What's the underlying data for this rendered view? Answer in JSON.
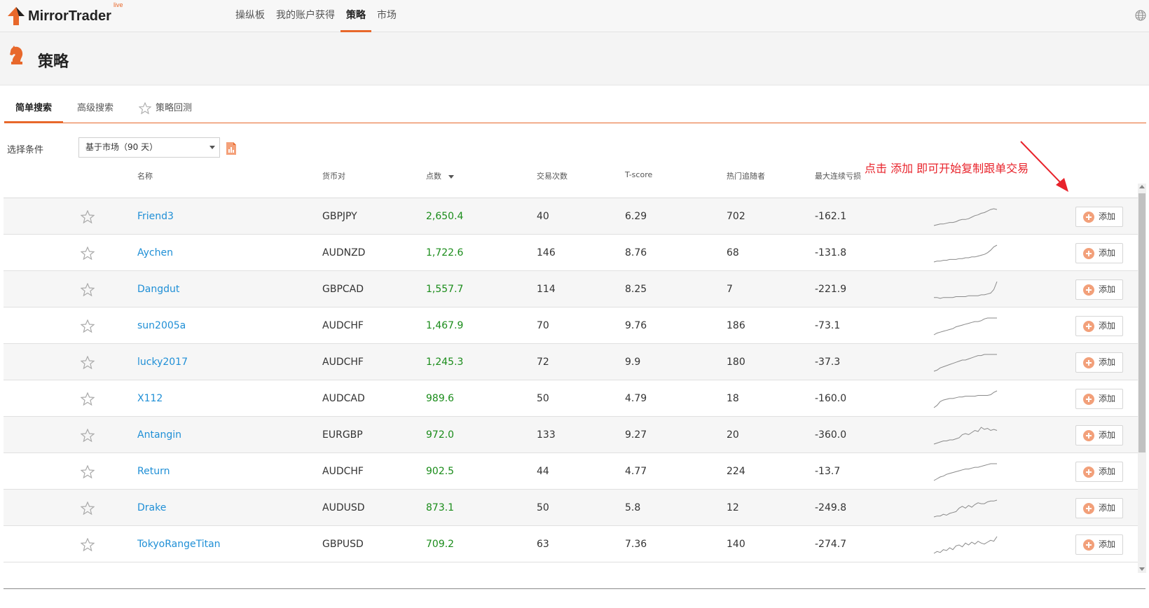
{
  "app": {
    "brand": "MirrorTrader",
    "brand_badge": "live"
  },
  "nav": {
    "items": [
      {
        "label": "操纵板",
        "active": false
      },
      {
        "label": "我的账户获得",
        "active": false
      },
      {
        "label": "策略",
        "active": true
      },
      {
        "label": "市场",
        "active": false
      }
    ]
  },
  "page": {
    "title": "策略"
  },
  "tabs": [
    {
      "label": "简单搜索",
      "active": true
    },
    {
      "label": "高级搜索",
      "active": false
    },
    {
      "label": "策略回测",
      "active": false,
      "icon": "star-outline-icon"
    }
  ],
  "filter": {
    "label": "选择条件",
    "selected": "基于市场（90 天）"
  },
  "table": {
    "headers": {
      "name": "名称",
      "pair": "货币对",
      "points": "点数",
      "trades": "交易次数",
      "tscore": "T-score",
      "followers": "热门追随者",
      "drawdown": "最大连续亏损"
    },
    "add_label": "添加",
    "rows": [
      {
        "name": "Friend3",
        "pair": "GBPJPY",
        "points": "2,650.4",
        "trades": "40",
        "tscore": "6.29",
        "followers": "702",
        "drawdown": "-162.1",
        "spark": [
          0,
          1,
          2,
          2,
          3,
          4,
          4,
          5,
          7,
          8,
          8,
          9,
          11,
          13,
          14,
          16,
          17,
          19,
          21,
          22,
          21
        ]
      },
      {
        "name": "Aychen",
        "pair": "AUDNZD",
        "points": "1,722.6",
        "trades": "146",
        "tscore": "8.76",
        "followers": "68",
        "drawdown": "-131.8",
        "spark": [
          0,
          1,
          1,
          2,
          2,
          3,
          3,
          3,
          4,
          4,
          5,
          5,
          6,
          6,
          7,
          8,
          9,
          11,
          14,
          18,
          20
        ]
      },
      {
        "name": "Dangdut",
        "pair": "GBPCAD",
        "points": "1,557.7",
        "trades": "114",
        "tscore": "8.25",
        "followers": "7",
        "drawdown": "-221.9",
        "spark": [
          1,
          1,
          0,
          1,
          1,
          1,
          1,
          2,
          2,
          2,
          2,
          3,
          3,
          3,
          3,
          4,
          4,
          5,
          6,
          10,
          19
        ]
      },
      {
        "name": "sun2005a",
        "pair": "AUDCHF",
        "points": "1,467.9",
        "trades": "70",
        "tscore": "9.76",
        "followers": "186",
        "drawdown": "-73.1",
        "spark": [
          0,
          2,
          3,
          4,
          5,
          6,
          7,
          9,
          10,
          11,
          12,
          13,
          14,
          15,
          15,
          16,
          18,
          19,
          19,
          19,
          19
        ]
      },
      {
        "name": "lucky2017",
        "pair": "AUDCHF",
        "points": "1,245.3",
        "trades": "72",
        "tscore": "9.9",
        "followers": "180",
        "drawdown": "-37.3",
        "spark": [
          0,
          1,
          3,
          4,
          5,
          6,
          7,
          8,
          9,
          10,
          10,
          11,
          12,
          13,
          14,
          14,
          15,
          15,
          15,
          15,
          15
        ]
      },
      {
        "name": "X112",
        "pair": "AUDCAD",
        "points": "989.6",
        "trades": "50",
        "tscore": "4.79",
        "followers": "18",
        "drawdown": "-160.0",
        "spark": [
          0,
          3,
          8,
          10,
          11,
          12,
          12,
          13,
          14,
          14,
          15,
          15,
          15,
          15,
          16,
          16,
          16,
          16,
          17,
          20,
          22
        ]
      },
      {
        "name": "Antangin",
        "pair": "EURGBP",
        "points": "972.0",
        "trades": "133",
        "tscore": "9.27",
        "followers": "20",
        "drawdown": "-360.0",
        "spark": [
          0,
          1,
          2,
          3,
          3,
          4,
          4,
          5,
          6,
          9,
          10,
          9,
          11,
          13,
          12,
          16,
          14,
          15,
          13,
          14,
          13
        ]
      },
      {
        "name": "Return",
        "pair": "AUDCHF",
        "points": "902.5",
        "trades": "44",
        "tscore": "4.77",
        "followers": "224",
        "drawdown": "-13.7",
        "spark": [
          0,
          2,
          4,
          5,
          7,
          8,
          9,
          10,
          11,
          12,
          13,
          13,
          14,
          15,
          15,
          16,
          17,
          18,
          19,
          19,
          19
        ]
      },
      {
        "name": "Drake",
        "pair": "AUDUSD",
        "points": "873.1",
        "trades": "50",
        "tscore": "5.8",
        "followers": "12",
        "drawdown": "-249.8",
        "spark": [
          0,
          1,
          1,
          3,
          2,
          4,
          5,
          6,
          10,
          12,
          10,
          13,
          11,
          14,
          16,
          15,
          15,
          17,
          18,
          18,
          19
        ]
      },
      {
        "name": "TokyoRangeTitan",
        "pair": "GBPUSD",
        "points": "709.2",
        "trades": "63",
        "tscore": "7.36",
        "followers": "140",
        "drawdown": "-274.7",
        "spark": [
          2,
          4,
          3,
          6,
          5,
          8,
          6,
          10,
          11,
          9,
          13,
          11,
          14,
          12,
          15,
          13,
          12,
          14,
          16,
          15,
          20
        ]
      }
    ]
  },
  "annotation": "点击 添加 即可开始复制跟单交易",
  "colors": {
    "accent": "#e8682b",
    "link": "#1f8fd6",
    "positive": "#1a8c1a",
    "annotation": "#e8232b"
  }
}
